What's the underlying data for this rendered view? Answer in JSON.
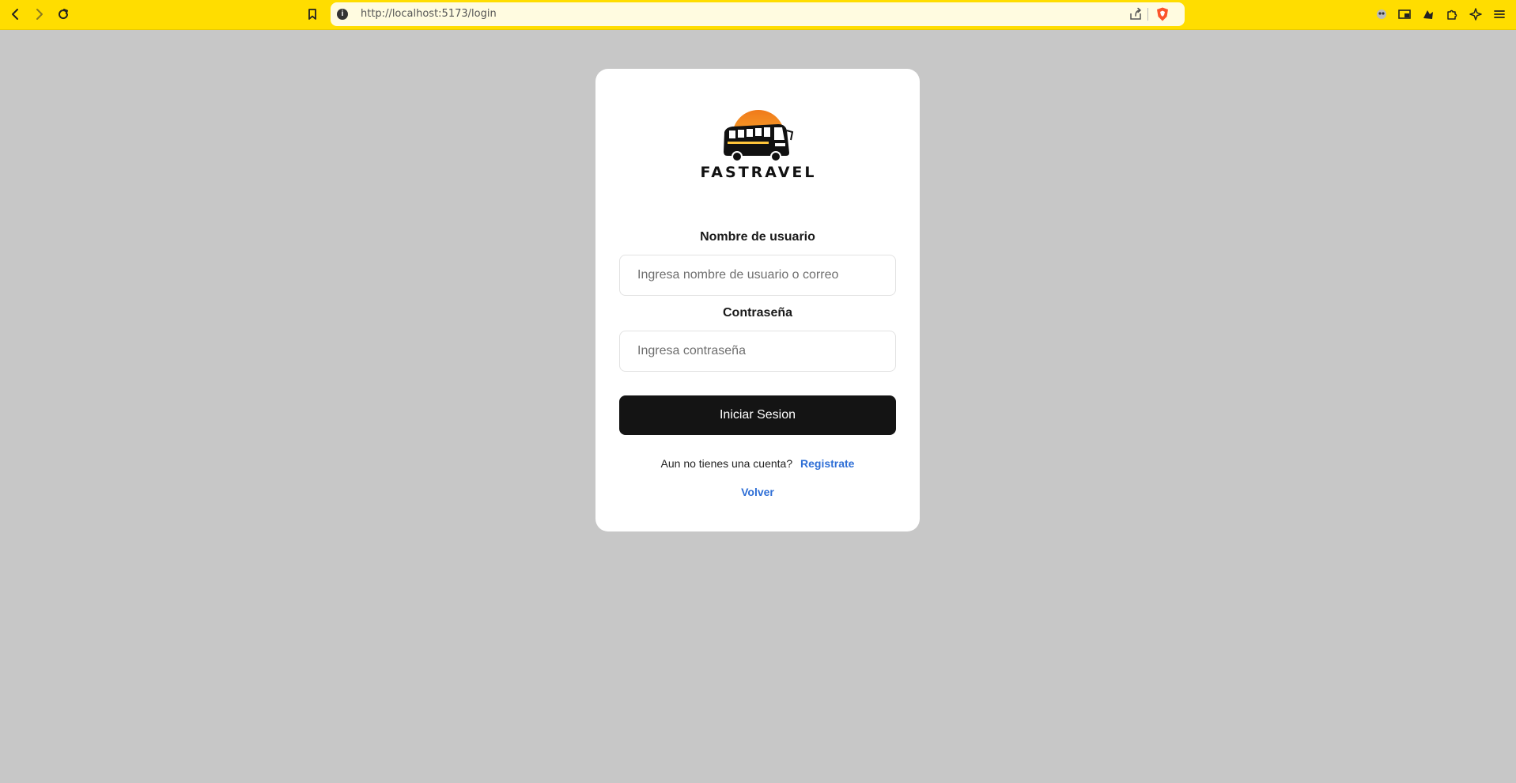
{
  "browser": {
    "url": "http://localhost:5173/login",
    "info_icon": "i",
    "toolbar_icons": [
      "back-icon",
      "forward-icon",
      "reload-icon",
      "bookmark-icon",
      "share-icon",
      "brave-shield-icon",
      "extension-1-icon",
      "picture-in-picture-icon",
      "extension-2-icon",
      "puzzle-icon",
      "leo-ai-icon",
      "menu-icon"
    ],
    "toolbar_color": "#ffdd00"
  },
  "login": {
    "brand": "FASTRAVEL",
    "username_label": "Nombre de usuario",
    "username_placeholder": "Ingresa nombre de usuario o correo",
    "password_label": "Contraseña",
    "password_placeholder": "Ingresa contraseña",
    "submit_label": "Iniciar Sesion",
    "register_prompt": "Aun no tienes una cuenta?",
    "register_link": "Registrate",
    "back_link": "Volver"
  },
  "colors": {
    "page_background": "#c7c7c7",
    "card_background": "#ffffff",
    "button_background": "#141414",
    "link": "#2f6fd6"
  }
}
